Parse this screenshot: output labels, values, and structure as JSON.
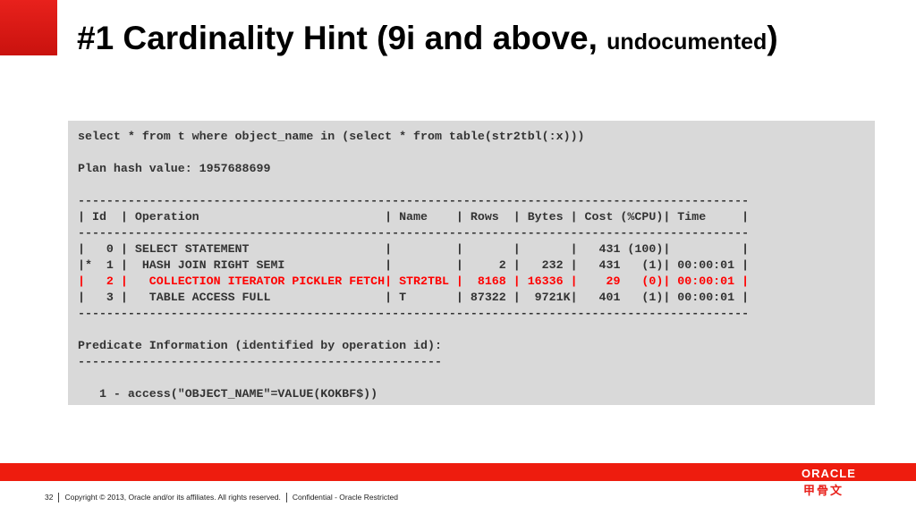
{
  "slide": {
    "title_main": "#1 Cardinality Hint (9i and above, ",
    "title_sub": "undocumented",
    "title_close": ")"
  },
  "code_lines": [
    {
      "text": "select * from t where object_name in (select * from table(str2tbl(:x)))",
      "highlight": false
    },
    {
      "text": "",
      "highlight": false
    },
    {
      "text": "Plan hash value: 1957688699",
      "highlight": false
    },
    {
      "text": "",
      "highlight": false
    },
    {
      "text": "----------------------------------------------------------------------------------------------",
      "highlight": false
    },
    {
      "text": "| Id  | Operation                          | Name    | Rows  | Bytes | Cost (%CPU)| Time     |",
      "highlight": false
    },
    {
      "text": "----------------------------------------------------------------------------------------------",
      "highlight": false
    },
    {
      "text": "|   0 | SELECT STATEMENT                   |         |       |       |   431 (100)|          |",
      "highlight": false
    },
    {
      "text": "|*  1 |  HASH JOIN RIGHT SEMI              |         |     2 |   232 |   431   (1)| 00:00:01 |",
      "highlight": false
    },
    {
      "text": "|   2 |   COLLECTION ITERATOR PICKLER FETCH| STR2TBL |  8168 | 16336 |    29   (0)| 00:00:01 |",
      "highlight": true
    },
    {
      "text": "|   3 |   TABLE ACCESS FULL                | T       | 87322 |  9721K|   401   (1)| 00:00:01 |",
      "highlight": false
    },
    {
      "text": "----------------------------------------------------------------------------------------------",
      "highlight": false
    },
    {
      "text": "",
      "highlight": false
    },
    {
      "text": "Predicate Information (identified by operation id):",
      "highlight": false
    },
    {
      "text": "---------------------------------------------------",
      "highlight": false
    },
    {
      "text": "",
      "highlight": false
    },
    {
      "text": "   1 - access(\"OBJECT_NAME\"=VALUE(KOKBF$))",
      "highlight": false
    }
  ],
  "footer": {
    "page_number": "32",
    "copyright": "Copyright © 2013, Oracle and/or its affiliates. All rights reserved.",
    "classification": "Confidential - Oracle Restricted"
  },
  "branding": {
    "oracle_logo": "ORACLE",
    "chinese_logo": "甲骨文"
  },
  "colors": {
    "accent_red": "#ee1c0e",
    "highlight_text": "#ff0000",
    "code_background": "#d9d9d9"
  }
}
